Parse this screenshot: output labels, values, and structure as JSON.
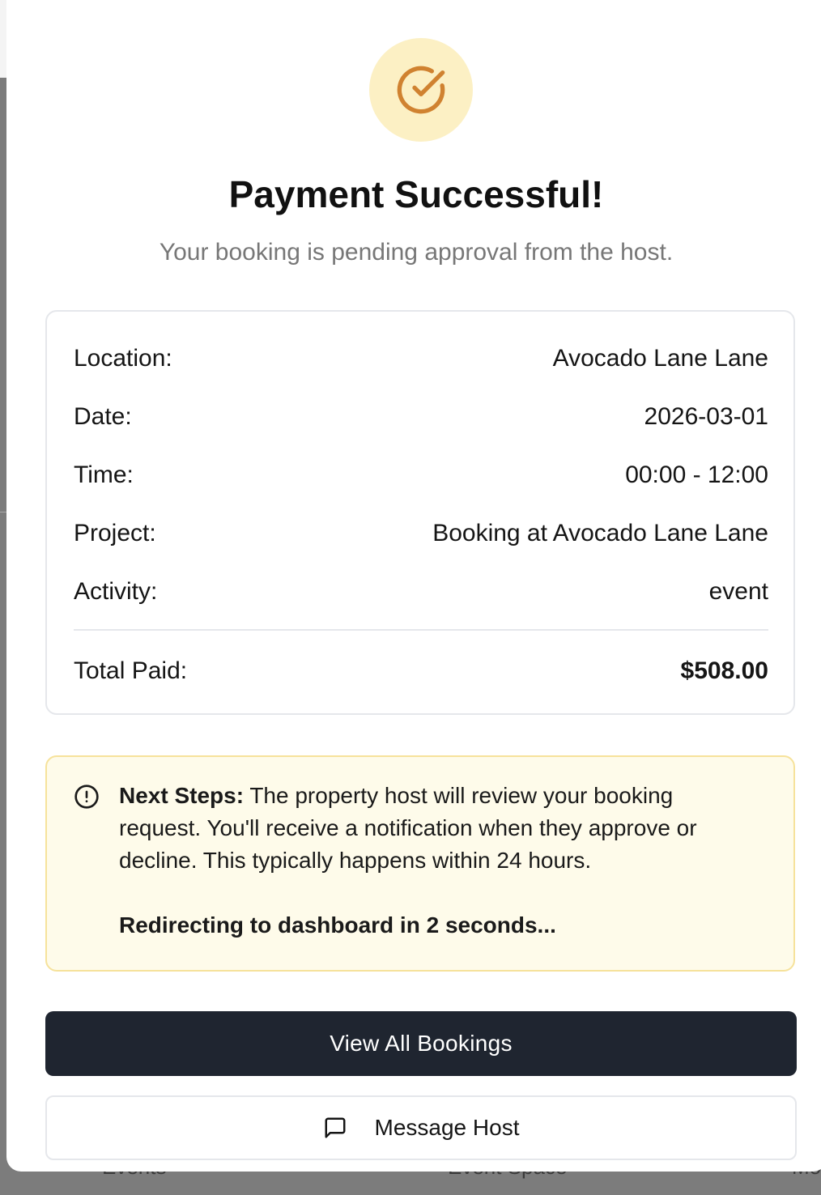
{
  "modal": {
    "icon": "check-circle-icon",
    "accent_color": "#d08230",
    "icon_bg_color": "#fcf0c4",
    "title": "Payment Successful!",
    "subtitle": "Your booking is pending approval from the host."
  },
  "details": {
    "location_label": "Location:",
    "location_value": "Avocado Lane Lane",
    "date_label": "Date:",
    "date_value": "2026-03-01",
    "time_label": "Time:",
    "time_value": "00:00 - 12:00",
    "project_label": "Project:",
    "project_value": "Booking at Avocado Lane Lane",
    "activity_label": "Activity:",
    "activity_value": "event",
    "total_label": "Total Paid:",
    "total_value": "$508.00"
  },
  "notice": {
    "icon": "alert-circle-icon",
    "heading": "Next Steps:",
    "body": " The property host will review your booking request. You'll receive a notification when they approve or decline. This typically happens within 24 hours.",
    "redirect": "Redirecting to dashboard in 2 seconds..."
  },
  "actions": {
    "primary_label": "View All Bookings",
    "secondary_label": "Message Host",
    "secondary_icon": "message-square-icon"
  },
  "background": {
    "nav_items": [
      "Events",
      "Event Space",
      "Mo"
    ]
  }
}
